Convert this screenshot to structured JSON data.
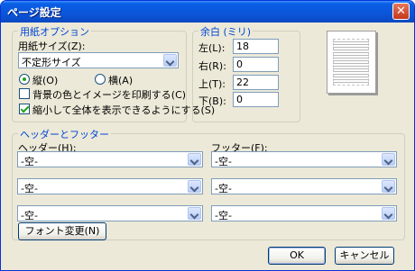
{
  "window": {
    "title": "ページ設定"
  },
  "paper": {
    "group_caption": "用紙オプション",
    "size_label": "用紙サイズ(Z):",
    "size_value": "不定形サイズ",
    "portrait_label": "縦(O)",
    "landscape_label": "横(A)",
    "orientation_selected": "portrait",
    "bg_print_label": "背景の色とイメージを印刷する(C)",
    "bg_print_checked": false,
    "shrink_label": "縮小して全体を表示できるようにする(S)",
    "shrink_checked": true
  },
  "margins": {
    "group_caption": "余白 (ミリ)",
    "left_label": "左(L):",
    "left_value": "18",
    "right_label": "右(R):",
    "right_value": "0",
    "top_label": "上(T):",
    "top_value": "22",
    "bottom_label": "下(B):",
    "bottom_value": "0"
  },
  "headerfooter": {
    "group_caption": "ヘッダーとフッター",
    "header_label": "ヘッダー(H):",
    "footer_label": "フッター(F):",
    "header_values": [
      "-空-",
      "-空-",
      "-空-"
    ],
    "footer_values": [
      "-空-",
      "-空-",
      "-空-"
    ],
    "font_button": "フォント変更(N)"
  },
  "buttons": {
    "ok": "OK",
    "cancel": "キャンセル"
  },
  "icons": {
    "close": "close-icon",
    "dropdown": "chevron-down-icon"
  }
}
